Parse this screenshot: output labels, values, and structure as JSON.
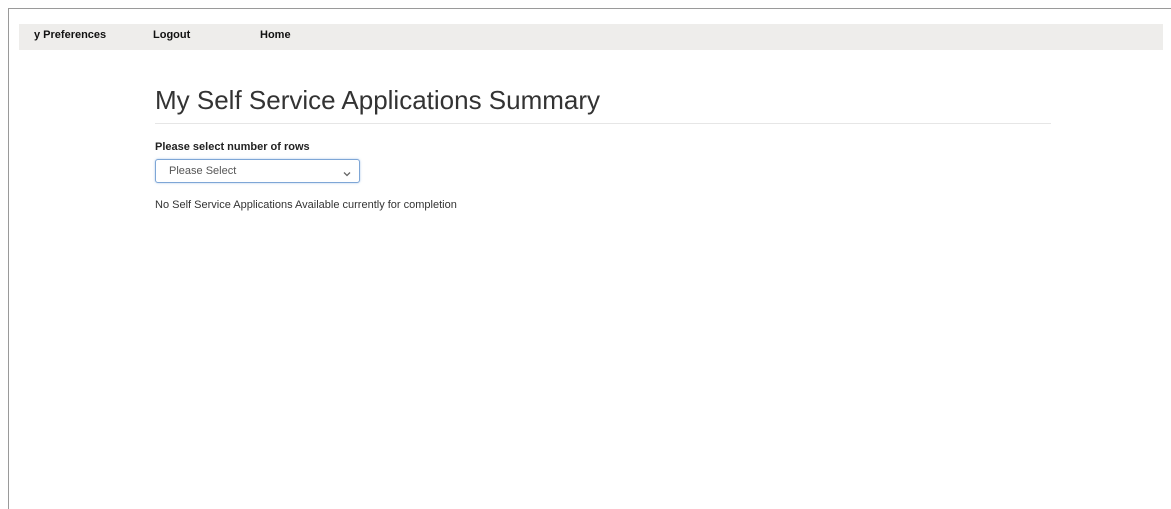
{
  "navbar": {
    "items": [
      {
        "label": "y Preferences"
      },
      {
        "label": "Logout"
      },
      {
        "label": "Home"
      }
    ]
  },
  "main": {
    "title": "My Self Service Applications Summary",
    "rows_label": "Please select number of rows",
    "rows_select": {
      "selected": "Please Select"
    },
    "empty_message": "No Self Service Applications Available currently for completion"
  },
  "colors": {
    "navbar_bg": "#eeedeb",
    "select_border": "#7ea6d6",
    "title_text": "#333333"
  },
  "icons": {
    "select_arrow": "chevron-down-icon"
  }
}
